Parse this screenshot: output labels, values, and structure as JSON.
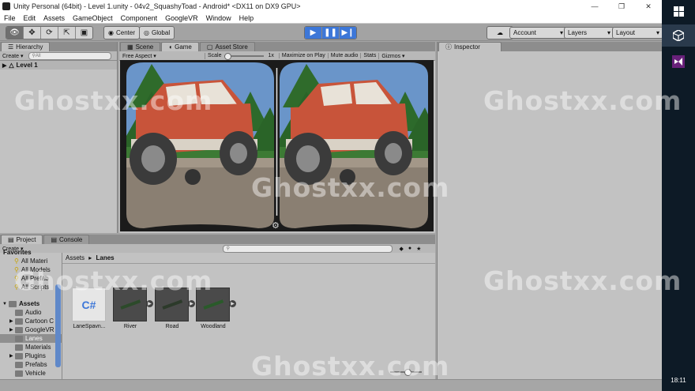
{
  "window": {
    "title": "Unity Personal (64bit) - Level 1.unity - 04v2_SquashyToad - Android* <DX11 on DX9 GPU>"
  },
  "menu": [
    "File",
    "Edit",
    "Assets",
    "GameObject",
    "Component",
    "GoogleVR",
    "Window",
    "Help"
  ],
  "toolbar": {
    "pivot_label": "Center",
    "space_label": "Global",
    "account_label": "Account",
    "layers_label": "Layers",
    "layout_label": "Layout"
  },
  "hierarchy": {
    "tab": "Hierarchy",
    "create_label": "Create",
    "search_placeholder": "All",
    "scene_name": "Level 1"
  },
  "game": {
    "tabs": [
      "Scene",
      "Game",
      "Asset Store"
    ],
    "aspect_label": "Free Aspect",
    "scale_label": "Scale",
    "scale_value": "1x",
    "buttons": [
      "Maximize on Play",
      "Mute audio",
      "Stats",
      "Gizmos"
    ]
  },
  "inspector": {
    "tab": "Inspector"
  },
  "project": {
    "tabs": [
      "Project",
      "Console"
    ],
    "create_label": "Create",
    "breadcrumb_root": "Assets",
    "breadcrumb_current": "Lanes",
    "favorites_label": "Favorites",
    "favorites": [
      "All Materi",
      "All Models",
      "All Prefab",
      "All Scripts"
    ],
    "assets_root": "Assets",
    "folders": [
      "Audio",
      "Cartoon C",
      "GoogleVR",
      "Lanes",
      "Materials",
      "Plugins",
      "Prefabs",
      "Vehicle"
    ],
    "assets": [
      {
        "name": "LaneSpavn...",
        "kind": "script"
      },
      {
        "name": "River",
        "kind": "prefab"
      },
      {
        "name": "Road",
        "kind": "prefab"
      },
      {
        "name": "Woodland",
        "kind": "prefab"
      }
    ]
  },
  "taskbar": {
    "clock": "18:11"
  },
  "watermark": "Ghostxx.com",
  "colors": {
    "play_blue": "#3d77d8",
    "car_red": "#c8543a",
    "taskbar": "#0d1a26"
  }
}
